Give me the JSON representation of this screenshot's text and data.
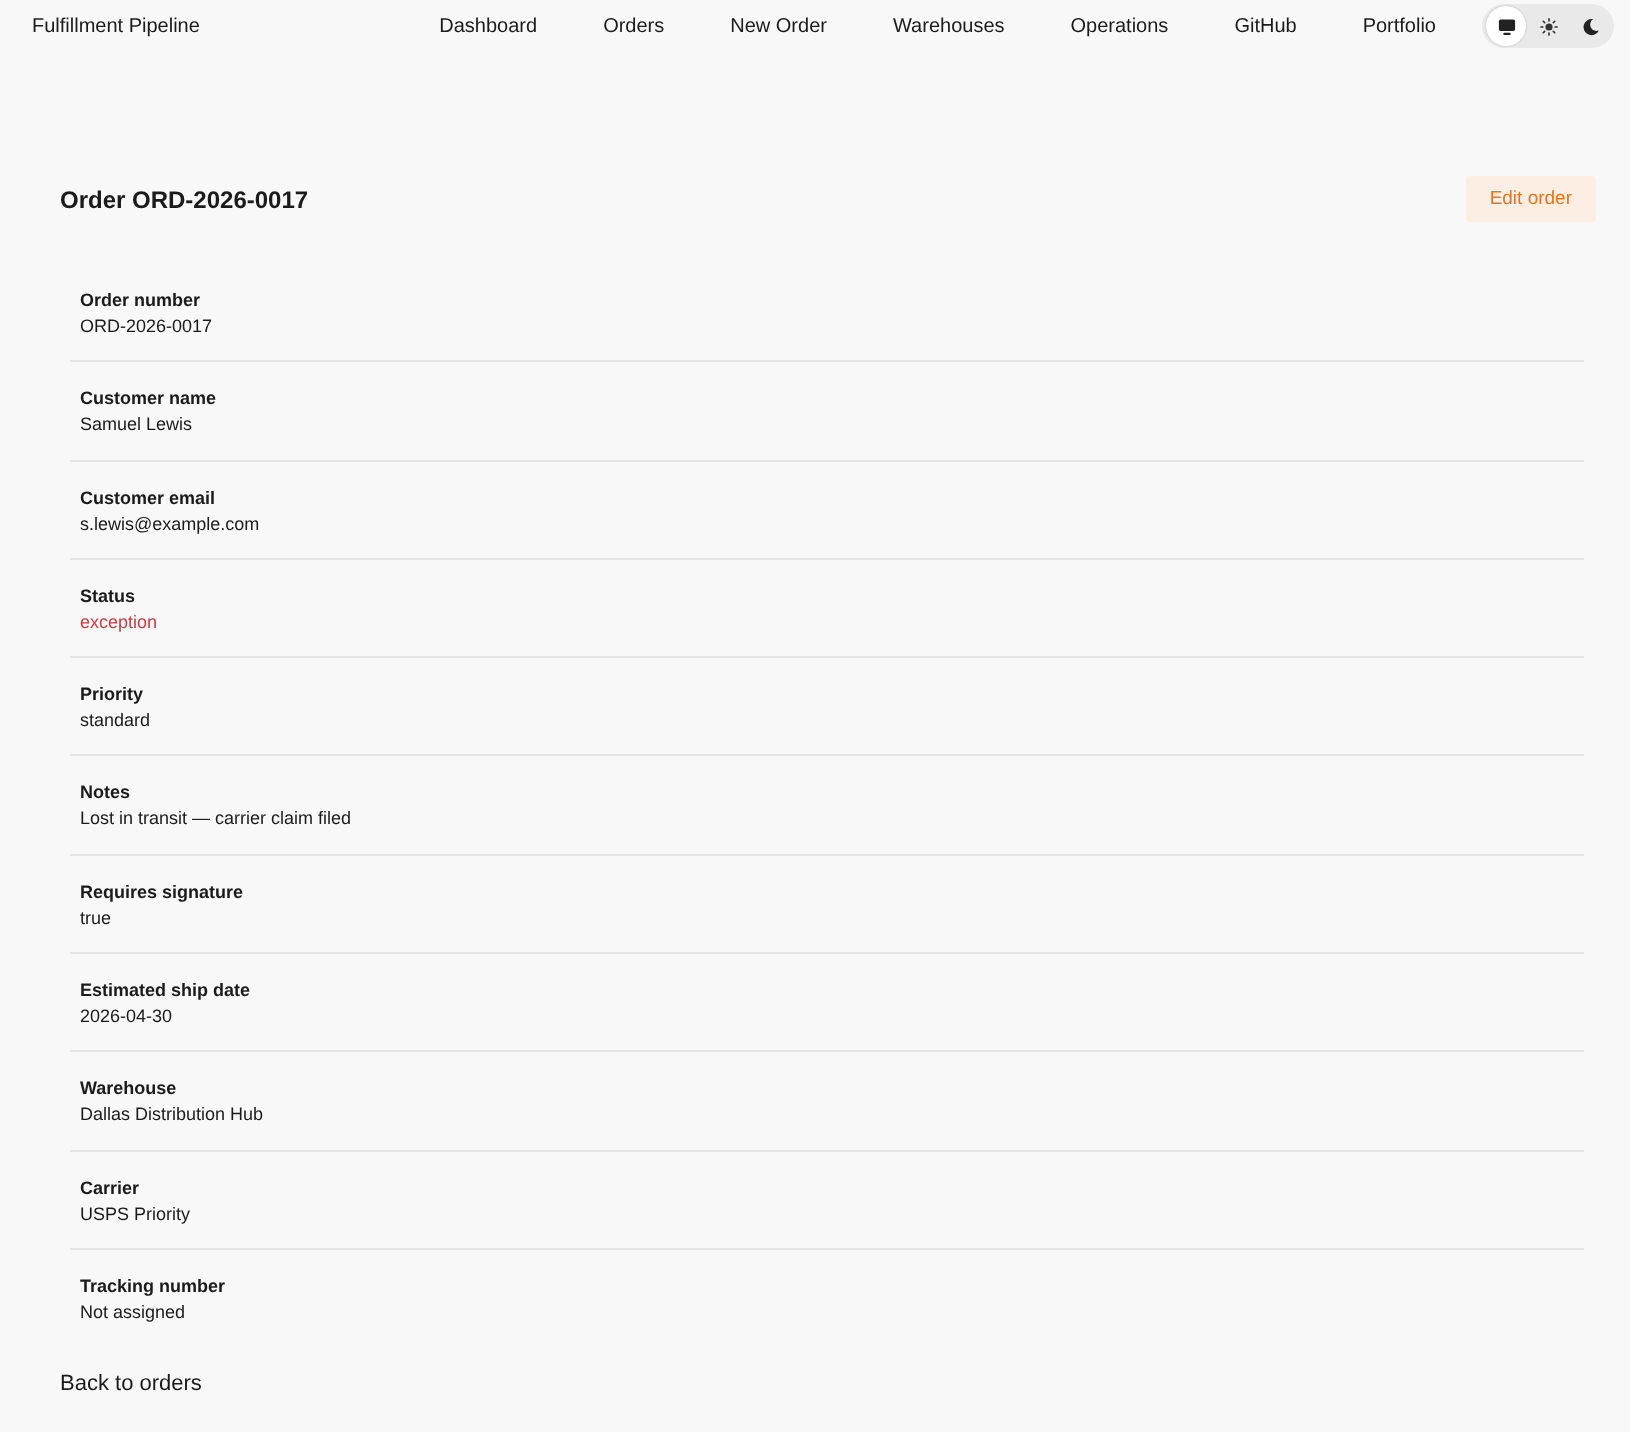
{
  "nav": {
    "brand": "Fulfillment Pipeline",
    "links": [
      {
        "label": "Dashboard"
      },
      {
        "label": "Orders"
      },
      {
        "label": "New Order"
      },
      {
        "label": "Warehouses"
      },
      {
        "label": "Operations"
      },
      {
        "label": "GitHub"
      },
      {
        "label": "Portfolio"
      }
    ],
    "theme_options": [
      {
        "kind": "system",
        "selected": true
      },
      {
        "kind": "light",
        "selected": false
      },
      {
        "kind": "dark",
        "selected": false
      }
    ]
  },
  "order": {
    "title": "Order ORD-2026-0017",
    "edit_button": "Edit order",
    "fields": [
      {
        "label": "Order number",
        "value": "ORD-2026-0017"
      },
      {
        "label": "Customer name",
        "value": "Samuel Lewis"
      },
      {
        "label": "Customer email",
        "value": "s.lewis@example.com"
      },
      {
        "label": "Status",
        "value": "exception",
        "color": "#d0393f"
      },
      {
        "label": "Priority",
        "value": "standard"
      },
      {
        "label": "Notes",
        "value": "Lost in transit — carrier claim filed"
      },
      {
        "label": "Requires signature",
        "value": "true"
      },
      {
        "label": "Estimated ship date",
        "value": "2026-04-30"
      },
      {
        "label": "Warehouse",
        "value": "Dallas Distribution Hub"
      },
      {
        "label": "Carrier",
        "value": "USPS Priority"
      },
      {
        "label": "Tracking number",
        "value": "Not assigned"
      }
    ]
  },
  "back_link": "Back to orders"
}
